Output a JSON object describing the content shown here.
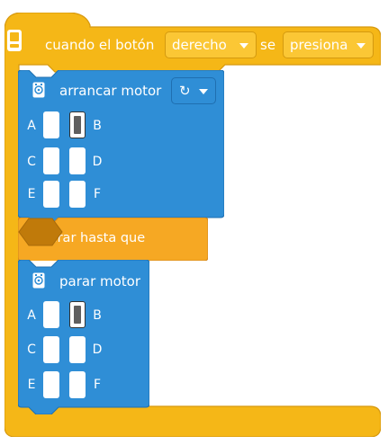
{
  "colors": {
    "event_yellow": "#f5b717",
    "event_border": "#d7990f",
    "motor_blue": "#2f8ed6",
    "motor_border": "#1f6fb0",
    "wait_orange": "#f6a823",
    "wait_border": "#d3861b",
    "hex_slot": "#c07a0a"
  },
  "event_block": {
    "icon": "hub-button-icon",
    "label_before": "cuando el botón",
    "button_value": "derecho",
    "label_between": "se",
    "action_value": "presiona"
  },
  "start_motor_block": {
    "icon": "motor-icon",
    "title": "arrancar motor",
    "direction_icon": "clockwise-arrow-icon",
    "direction_glyph": "↻",
    "ports": [
      {
        "left_label": "A",
        "right_label": "B",
        "left_selected": false,
        "right_selected": true
      },
      {
        "left_label": "C",
        "right_label": "D",
        "left_selected": false,
        "right_selected": false
      },
      {
        "left_label": "E",
        "right_label": "F",
        "left_selected": false,
        "right_selected": false
      }
    ]
  },
  "wait_block": {
    "label": "esperar hasta que",
    "slot": "empty-boolean-slot"
  },
  "stop_motor_block": {
    "icon": "motor-icon",
    "title": "parar motor",
    "ports": [
      {
        "left_label": "A",
        "right_label": "B",
        "left_selected": false,
        "right_selected": true
      },
      {
        "left_label": "C",
        "right_label": "D",
        "left_selected": false,
        "right_selected": false
      },
      {
        "left_label": "E",
        "right_label": "F",
        "left_selected": false,
        "right_selected": false
      }
    ]
  }
}
